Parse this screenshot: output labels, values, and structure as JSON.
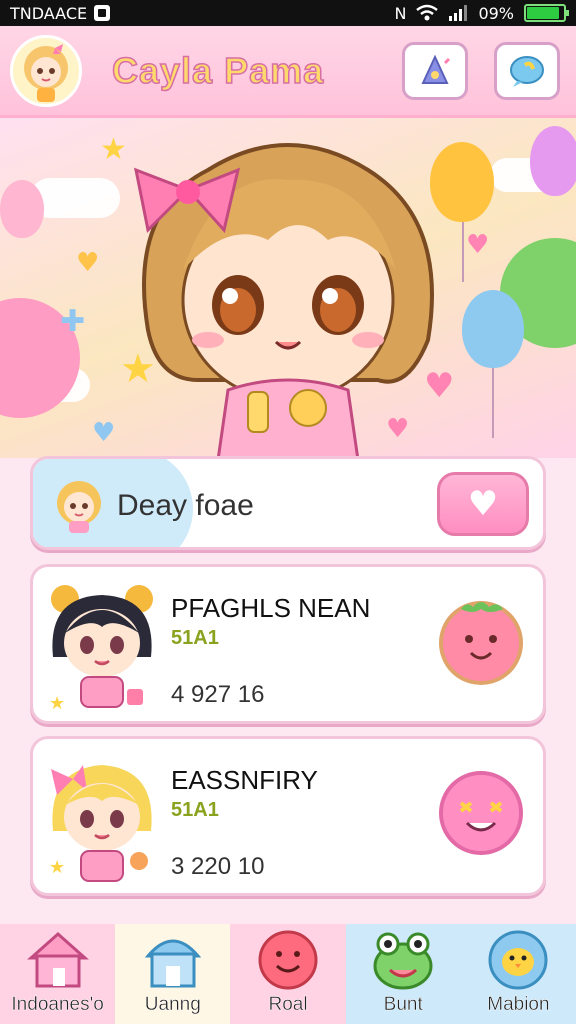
{
  "status_bar": {
    "carrier": "TNDAACE",
    "network": "N",
    "battery_text": "09%",
    "battery_level": 0.9
  },
  "header": {
    "title": "Cayla Pama",
    "buttons": [
      {
        "icon": "bell-icon"
      },
      {
        "icon": "chat-icon"
      }
    ]
  },
  "daily": {
    "label": "Deay foae",
    "button_icon": "heart-icon"
  },
  "players": [
    {
      "name": "PFAGHLS NEAN",
      "level": "51A1",
      "score": "4 927 16",
      "button_icon": "peach-face-icon"
    },
    {
      "name": "EASSNFIRY",
      "level": "51A1",
      "score": "3 220 10",
      "button_icon": "winking-face-icon"
    }
  ],
  "nav": [
    {
      "label": "Indoanes'o",
      "icon": "house-icon"
    },
    {
      "label": "Uanng",
      "icon": "shop-icon"
    },
    {
      "label": "Roal",
      "icon": "smile-ball-icon"
    },
    {
      "label": "Bunt",
      "icon": "frog-icon"
    },
    {
      "label": "Mabion",
      "icon": "chick-icon"
    }
  ],
  "colors": {
    "accent_pink": "#ff8ec1",
    "title_yellow": "#ffd96b",
    "level_green": "#8aa31f"
  }
}
